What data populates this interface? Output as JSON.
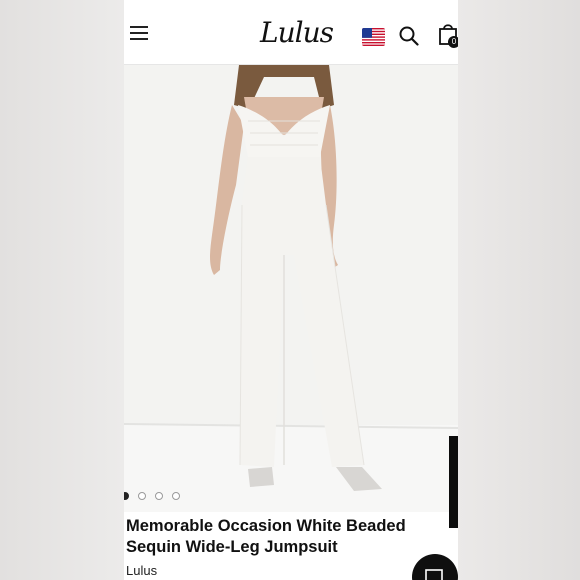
{
  "header": {
    "menu_icon": "hamburger-menu-icon",
    "logo": "Lulus",
    "flag_icon": "us-flag-icon",
    "search_icon": "search-icon",
    "bag_icon": "shopping-bag-icon",
    "bag_count": "0"
  },
  "gallery": {
    "image_alt": "Model wearing white beaded sequin wide-leg jumpsuit",
    "slide_count": 4,
    "active_slide": 1
  },
  "product": {
    "title_line1": "Memorable Occasion White Beaded",
    "title_line2": "Sequin Wide-Leg Jumpsuit",
    "brand": "Lulus"
  },
  "chat": {
    "icon": "chat-icon"
  },
  "colors": {
    "background": "#ffffff",
    "text": "#111111",
    "hero_background": "#f3f3f1"
  }
}
